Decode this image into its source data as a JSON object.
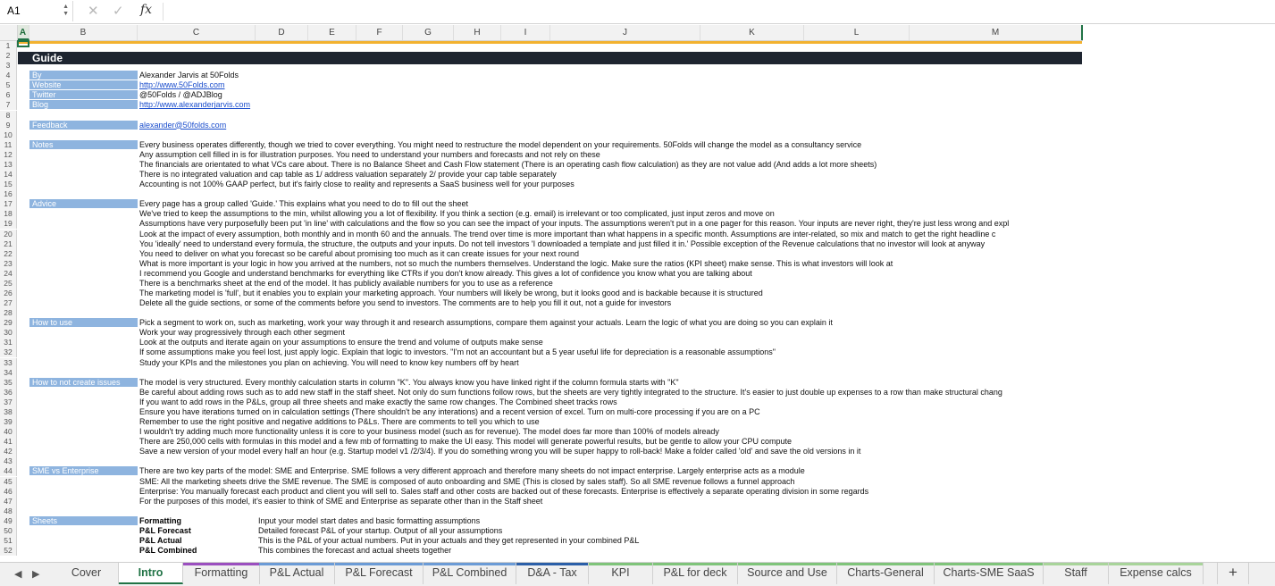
{
  "formula_bar": {
    "cell_ref": "A1",
    "fx": "fx",
    "cancel": "✕",
    "confirm": "✓"
  },
  "columns": [
    "A",
    "B",
    "C",
    "D",
    "E",
    "F",
    "G",
    "H",
    "I",
    "J",
    "K",
    "L",
    "M"
  ],
  "title": "Guide",
  "rows": [
    {
      "n": "1"
    },
    {
      "n": "2"
    },
    {
      "n": "3"
    },
    {
      "n": "4",
      "label": "By",
      "value": "Alexander Jarvis at 50Folds"
    },
    {
      "n": "5",
      "label": "Website",
      "value": "http://www.50Folds.com",
      "link": true
    },
    {
      "n": "6",
      "label": "Twitter",
      "value": "@50Folds / @ADJBlog"
    },
    {
      "n": "7",
      "label": "Blog",
      "value": "http://www.alexanderjarvis.com",
      "link": true
    },
    {
      "n": "8"
    },
    {
      "n": "9",
      "label": "Feedback",
      "value": "alexander@50folds.com",
      "link": true
    },
    {
      "n": "10"
    },
    {
      "n": "11",
      "label": "Notes",
      "value": "Every business operates differently, though we tried to cover everything. You might need to restructure the model dependent on your requirements. 50Folds will change the model as a consultancy service"
    },
    {
      "n": "12",
      "value": "Any assumption cell filled in is for illustration purposes. You need to understand your numbers and forecasts and not rely on these"
    },
    {
      "n": "13",
      "value": "The financials are orientated to what VCs care about. There is no Balance Sheet and Cash Flow statement (There is an operating cash flow calculation) as they are not value add (And adds a lot more sheets)"
    },
    {
      "n": "14",
      "value": "There is no integrated valuation and cap table as 1/ address valuation separately 2/ provide your cap table separately"
    },
    {
      "n": "15",
      "value": "Accounting is not 100% GAAP perfect, but it's fairly close to reality and represents a SaaS business well for your purposes"
    },
    {
      "n": "16"
    },
    {
      "n": "17",
      "label": "Advice",
      "value": "Every page has a group called 'Guide.' This explains what you need to do to fill out the sheet"
    },
    {
      "n": "18",
      "value": "We've tried to keep the assumptions to the min, whilst allowing you a lot of flexibility. If you think a section (e.g. email) is irrelevant or too complicated, just input zeros and move on"
    },
    {
      "n": "19",
      "value": "Assumptions have very purposefully been put 'in line' with calculations and the flow so you can see the impact of your inputs. The assumptions weren't put in a one pager for this reason. Your inputs are never right, they're just less wrong and expl"
    },
    {
      "n": "20",
      "value": "Look at the impact of every assumption, both monthly and in month 60 and the annuals. The trend over time is more important than what happens in a specific month. Assumptions are inter-related, so mix and match to get the right headline c"
    },
    {
      "n": "21",
      "value": "You 'ideally' need to understand every formula, the structure, the outputs and your inputs. Do not tell investors 'I downloaded a template and just filled it in.' Possible exception of the Revenue calculations that no investor will look at anyway"
    },
    {
      "n": "22",
      "value": "You need to deliver on what you forecast so be careful about promising too much as it can create issues for your next round"
    },
    {
      "n": "23",
      "value": "What is more important is your logic in how you arrived at the numbers, not so much the numbers themselves. Understand the logic. Make sure the ratios (KPI sheet) make sense. This is what investors will look at"
    },
    {
      "n": "24",
      "value": "I recommend you Google and understand benchmarks for everything like CTRs if you don't know already. This gives a lot of confidence you know what you are talking about"
    },
    {
      "n": "25",
      "value": "There is a benchmarks sheet at the end of the model. It has publicly available numbers for you to use as a reference"
    },
    {
      "n": "26",
      "value": "The marketing model is 'full', but it enables you to explain your marketing approach. Your numbers will likely be wrong, but it looks good and is backable because it is structured"
    },
    {
      "n": "27",
      "value": "Delete all the guide sections, or some of the comments before you send to investors. The comments are to help you fill it out, not a guide for investors"
    },
    {
      "n": "28"
    },
    {
      "n": "29",
      "label": "How to use",
      "value": "Pick a segment to work on, such as marketing, work your way through it and research assumptions, compare them against your actuals. Learn the logic of what you are doing so you can explain it"
    },
    {
      "n": "30",
      "value": "Work your way progressively through each other segment"
    },
    {
      "n": "31",
      "value": "Look at the outputs and iterate again on your assumptions to ensure the trend and volume of outputs make sense"
    },
    {
      "n": "32",
      "value": "If some assumptions make you feel lost, just apply logic. Explain that logic to investors. \"I'm not an accountant but a 5 year useful life for depreciation is a reasonable assumptions\""
    },
    {
      "n": "33",
      "value": "Study your KPIs and the milestones you plan on achieving. You will need to know key numbers off by heart"
    },
    {
      "n": "34"
    },
    {
      "n": "35",
      "label": "How to not create issues",
      "value": "The model is very structured. Every monthly calculation starts in column \"K\". You always know you have linked right if the column formula starts with \"K\""
    },
    {
      "n": "36",
      "value": "Be careful about adding rows such as to add new staff in the staff sheet. Not only do sum functions follow rows, but the sheets are very tightly integrated to the structure. It's easier to just double up expenses to a row than make structural chang"
    },
    {
      "n": "37",
      "value": "If you want to add rows in the P&Ls, group all three sheets and make exactly the same row changes. The Combined sheet tracks rows"
    },
    {
      "n": "38",
      "value": "Ensure you have iterations turned on in calculation settings (There shouldn't be any interations) and a recent version of excel. Turn on multi-core processing if you are on a PC"
    },
    {
      "n": "39",
      "value": "Remember to use the right positive and negative additions to P&Ls. There are comments to tell you which to use"
    },
    {
      "n": "40",
      "value": "I wouldn't try adding much more functionality unless it is core to your business model (such as for revenue). The model does far more than 100% of models already"
    },
    {
      "n": "41",
      "value": "There are 250,000 cells with formulas in this model and a few mb of formatting to make the UI easy. This model will generate powerful results, but be gentle to allow your CPU compute"
    },
    {
      "n": "42",
      "value": "Save a new version of your model every half an hour (e.g. Startup model v1 /2/3/4). If you do something wrong you will be super happy to roll-back! Make a folder called 'old' and save the old versions in it"
    },
    {
      "n": "43"
    },
    {
      "n": "44",
      "label": "SME vs Enterprise",
      "value": "There are two key parts of the model: SME and Enterprise. SME follows a very different approach and therefore many sheets do not impact enterprise. Largely enterprise acts as a module"
    },
    {
      "n": "45",
      "value": "SME: All the marketing sheets drive the SME revenue. The SME is composed of auto onboarding and SME (This is closed by sales staff). So all SME revenue follows a funnel approach"
    },
    {
      "n": "46",
      "value": "Enterprise: You manually forecast each product and client you will sell to. Sales staff and other costs are backed out of these forecasts. Enterprise is effectively a separate operating division in some regards"
    },
    {
      "n": "47",
      "value": "For the purposes of this model, it's easier to think of SME and Enterprise as separate other than in the Staff sheet"
    },
    {
      "n": "48"
    },
    {
      "n": "49",
      "label": "Sheets",
      "sheet": "Formatting",
      "desc": "Input your model start dates and basic formatting assumptions"
    },
    {
      "n": "50",
      "sheet": "P&L Forecast",
      "desc": "Detailed forecast P&L of your startup. Output of all your assumptions"
    },
    {
      "n": "51",
      "sheet": "P&L Actual",
      "desc": "This is the P&L of your actual numbers. Put in your actuals and they get represented in your combined P&L"
    },
    {
      "n": "52",
      "sheet": "P&L Combined",
      "desc": "This combines the forecast and actual sheets together"
    }
  ],
  "tabs": [
    {
      "label": "Cover",
      "color": ""
    },
    {
      "label": "Intro",
      "color": "",
      "active": true
    },
    {
      "label": "Formatting",
      "color": "#9b4fbf"
    },
    {
      "label": "P&L Actual",
      "color": "#6b9bd6"
    },
    {
      "label": "P&L Forecast",
      "color": "#6b9bd6"
    },
    {
      "label": "P&L Combined",
      "color": "#6b9bd6"
    },
    {
      "label": "D&A - Tax",
      "color": "#2b5fa8"
    },
    {
      "label": "KPI",
      "color": "#7fc47a"
    },
    {
      "label": "P&L for deck",
      "color": "#7fc47a"
    },
    {
      "label": "Source and Use",
      "color": "#7fc47a"
    },
    {
      "label": "Charts-General",
      "color": "#7fc47a"
    },
    {
      "label": "Charts-SME SaaS",
      "color": "#7fc47a"
    },
    {
      "label": "Staff",
      "color": "#a8d49a"
    },
    {
      "label": "Expense calcs",
      "color": "#a8d49a"
    }
  ],
  "add_sheet": "+"
}
